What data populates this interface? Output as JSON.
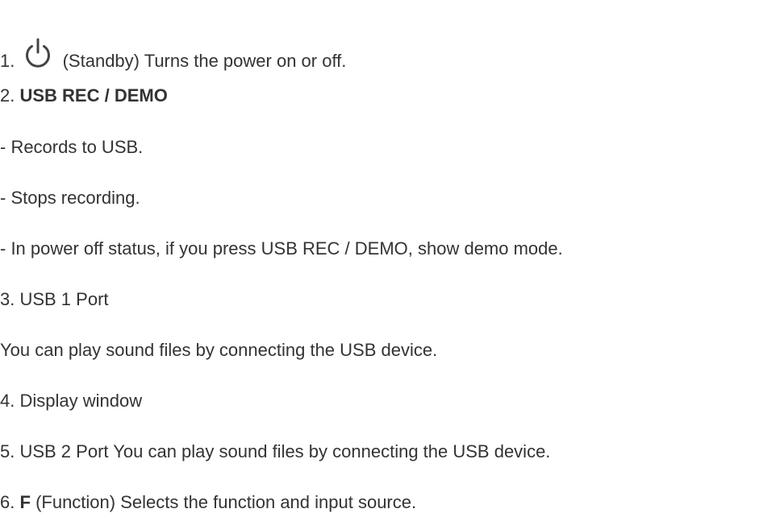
{
  "items": {
    "power": {
      "number": "1.",
      "icon": "power-standby-icon",
      "text": "(Standby) Turns the power on or off."
    },
    "usb_rec": {
      "number": "2.",
      "label": "USB REC / DEMO"
    },
    "usb_rec_bullets": [
      "- Records to USB.",
      "- Stops recording.",
      "- In power off status, if you press USB REC / DEMO, show demo mode."
    ],
    "usb1": {
      "title": "3. USB 1 Port",
      "description": "You can play sound files by connecting the USB device."
    },
    "display": {
      "title": "4. Display window"
    },
    "usb2": {
      "title": "5. USB 2 Port You can play sound files by connecting the USB device."
    },
    "function": {
      "number": "6.",
      "label": "F",
      "text": "(Function) Selects the function and input source."
    }
  },
  "colors": {
    "text": "#333333",
    "icon": "#444444"
  }
}
